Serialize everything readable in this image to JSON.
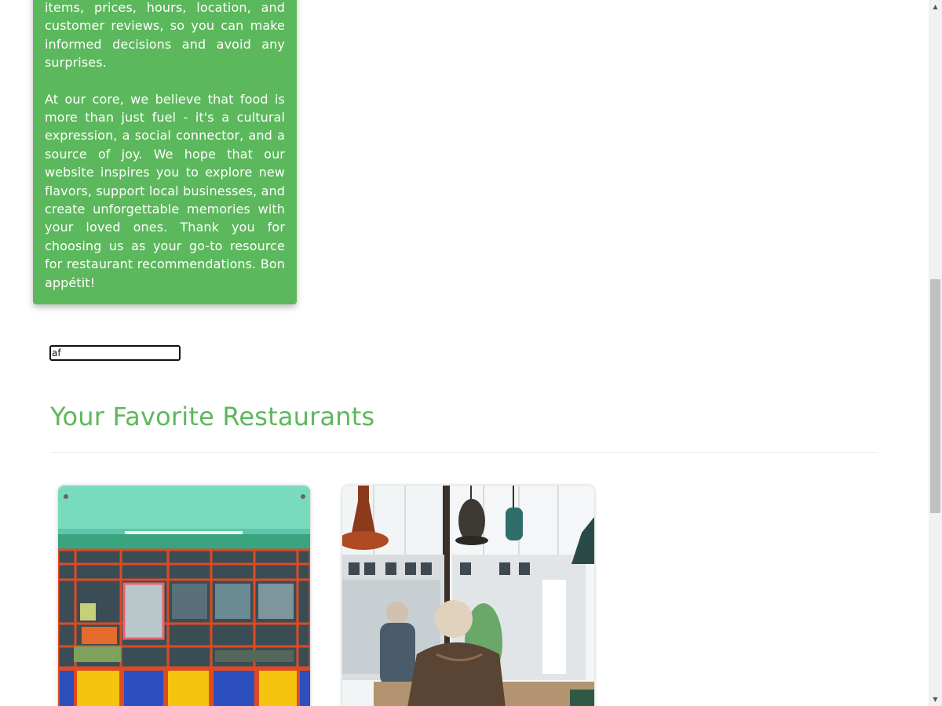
{
  "about": {
    "paragraph1": "items, prices, hours, location, and customer reviews, so you can make informed decisions and avoid any surprises.",
    "paragraph2": "At our core, we believe that food is more than just fuel - it's a cultural expression, a social connector, and a source of joy. We hope that our website inspires you to explore new flavors, support local businesses, and create unforgettable memories with your loved ones. Thank you for choosing us as your go-to resource for restaurant recommendations. Bon appétit!"
  },
  "search": {
    "value": "af"
  },
  "favorites": {
    "title": "Your Favorite Restaurants",
    "cards": [
      {
        "image": "colorful-storefront-image"
      },
      {
        "image": "cafe-interior-image"
      }
    ]
  },
  "scrollbar": {
    "up_icon": "▲",
    "down_icon": "▼"
  },
  "colors": {
    "accent": "#5cb85c",
    "card_text": "#ffffff"
  }
}
